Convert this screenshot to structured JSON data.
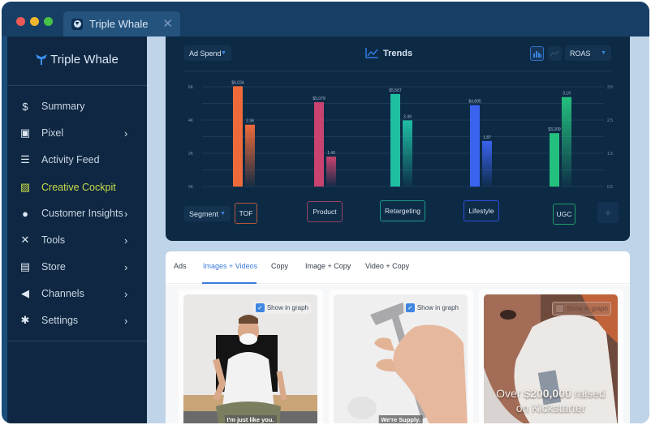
{
  "window": {
    "tab_title": "Triple Whale",
    "close_glyph": "✕"
  },
  "sidebar": {
    "brand": "Triple Whale",
    "items": [
      {
        "label": "Summary",
        "icon": "dollar-icon",
        "glyph": "$",
        "has_chevron": false,
        "active": false
      },
      {
        "label": "Pixel",
        "icon": "floppy-disk-icon",
        "glyph": "▣",
        "has_chevron": true,
        "active": false
      },
      {
        "label": "Activity Feed",
        "icon": "list-icon",
        "glyph": "☰",
        "has_chevron": false,
        "active": false
      },
      {
        "label": "Creative Cockpit",
        "icon": "image-icon",
        "glyph": "▨",
        "has_chevron": false,
        "active": true
      },
      {
        "label": "Customer Insights",
        "icon": "user-circle-icon",
        "glyph": "●",
        "has_chevron": true,
        "active": false
      },
      {
        "label": "Tools",
        "icon": "tools-icon",
        "glyph": "✕",
        "has_chevron": true,
        "active": false
      },
      {
        "label": "Store",
        "icon": "store-icon",
        "glyph": "▤",
        "has_chevron": true,
        "active": false
      },
      {
        "label": "Channels",
        "icon": "megaphone-icon",
        "glyph": "◀",
        "has_chevron": true,
        "active": false
      },
      {
        "label": "Settings",
        "icon": "gear-icon",
        "glyph": "✱",
        "has_chevron": true,
        "active": false
      }
    ],
    "chevron": "›"
  },
  "chart_panel": {
    "metric_left_dropdown": "Ad Spend",
    "title": "Trends",
    "metric_right_dropdown": "ROAS",
    "segment_dropdown": "Segment",
    "caret": "▼",
    "add_glyph": "+"
  },
  "chart_data": {
    "type": "bar",
    "title": "Trends",
    "categories": [
      "TOF",
      "Product",
      "Retargeting",
      "Lifestyle",
      "UGC"
    ],
    "colors": [
      "#ef6a3a",
      "#c8436f",
      "#1fbfa4",
      "#3a63f0",
      "#24c07e"
    ],
    "series": [
      {
        "name": "Ad Spend",
        "axis": "left",
        "values": [
          6034,
          5079,
          5567,
          4895,
          3209
        ],
        "labels": [
          "$6,034",
          "$5,079",
          "$5,567",
          "$4,895",
          "$3,209"
        ]
      },
      {
        "name": "ROAS",
        "axis": "right",
        "values": [
          2.36,
          1.4,
          2.49,
          1.87,
          3.19
        ],
        "labels": [
          "2.36",
          "1.40",
          "2.49",
          "1.87",
          "3.19"
        ]
      }
    ],
    "y_left": {
      "ticks": [
        "6K",
        "4K",
        "2K",
        "0K"
      ],
      "tick_values": [
        6000,
        4000,
        2000,
        0
      ],
      "range": [
        0,
        6000
      ]
    },
    "y_right": {
      "ticks": [
        "3.5",
        "2.5",
        "1.5",
        "0.5"
      ],
      "tick_values": [
        3.5,
        2.5,
        1.5,
        0.5
      ],
      "range": [
        0.5,
        3.5
      ]
    },
    "grid": true,
    "legend": "bottom"
  },
  "content": {
    "tabs": [
      {
        "label": "Ads",
        "active": false
      },
      {
        "label": "Images + Videos",
        "active": true
      },
      {
        "label": "Copy",
        "active": false
      },
      {
        "label": "Image + Copy",
        "active": false
      },
      {
        "label": "Video + Copy",
        "active": false
      }
    ],
    "cards": [
      {
        "show_in_graph_label": "Show in graph",
        "checked": true,
        "caption": "I'm just like you."
      },
      {
        "show_in_graph_label": "Show in graph",
        "checked": true,
        "caption": "We're Supply."
      },
      {
        "show_in_graph_label": "Show in graph",
        "checked": false,
        "promo_prefix": "Over ",
        "promo_amount": "$200,000",
        "promo_suffix": " raised",
        "promo_line2": "on Kickstarter"
      }
    ],
    "check_glyph": "✓"
  }
}
